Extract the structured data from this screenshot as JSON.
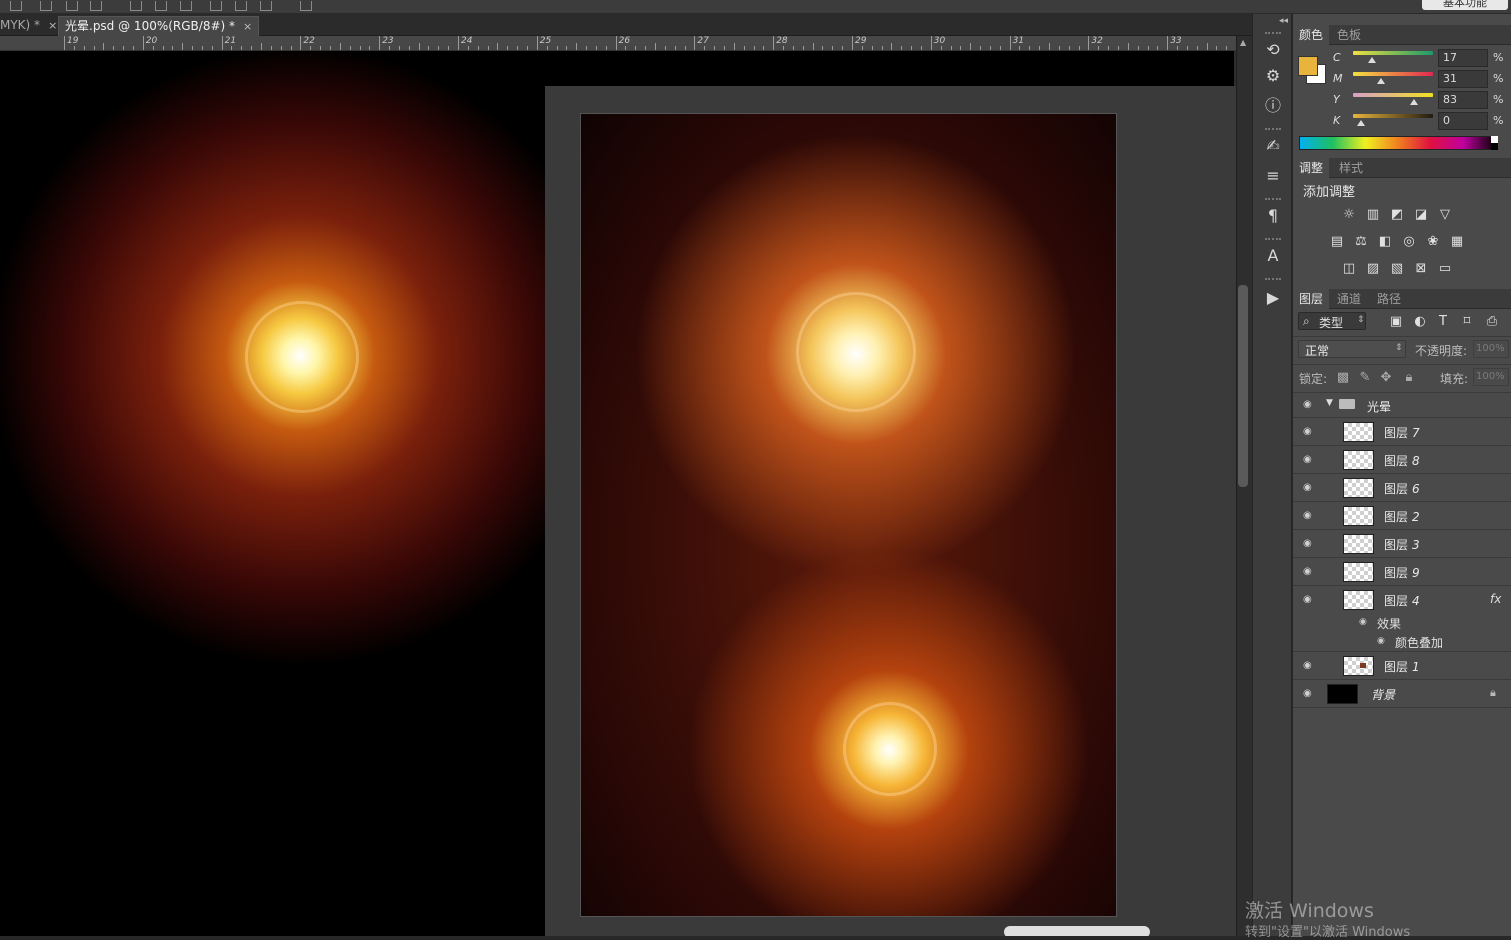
{
  "header": {
    "workspace_label": "基本功能"
  },
  "tabs": [
    {
      "label": "MYK) *",
      "close": "×"
    },
    {
      "label": "光晕.psd @ 100%(RGB/8#) *",
      "close": "×"
    }
  ],
  "ruler": {
    "numbers": [
      "19",
      "20",
      "21",
      "22",
      "23",
      "24",
      "25",
      "26",
      "27",
      "28",
      "29",
      "30",
      "31",
      "32",
      "33"
    ]
  },
  "color_panel": {
    "tabs": [
      "颜色",
      "色板"
    ],
    "foreground_color": "#e8b43c",
    "channels": [
      {
        "label": "C",
        "value": "17",
        "unit": "%",
        "level": 0.17
      },
      {
        "label": "M",
        "value": "31",
        "unit": "%",
        "level": 0.31
      },
      {
        "label": "Y",
        "value": "83",
        "unit": "%",
        "level": 0.83
      },
      {
        "label": "K",
        "value": "0",
        "unit": "%",
        "level": 0.0
      }
    ]
  },
  "adjust_panel": {
    "tabs": [
      "调整",
      "样式"
    ],
    "title": "添加调整"
  },
  "layers_panel": {
    "tabs": [
      "图层",
      "通道",
      "路径"
    ],
    "filter_label": "类型",
    "blend_mode": "正常",
    "opacity_label": "不透明度:",
    "opacity_value": "100%",
    "lock_label": "锁定:",
    "fill_label": "填充:",
    "fill_value": "100%",
    "group_name": "光晕",
    "layers": [
      {
        "name": "图层",
        "num": "7"
      },
      {
        "name": "图层",
        "num": "8"
      },
      {
        "name": "图层",
        "num": "6"
      },
      {
        "name": "图层",
        "num": "2"
      },
      {
        "name": "图层",
        "num": "3"
      },
      {
        "name": "图层",
        "num": "9"
      },
      {
        "name": "图层",
        "num": "4",
        "fx": "fx"
      }
    ],
    "effects_label": "效果",
    "effect_item": "颜色叠加",
    "layer1": {
      "name": "图层",
      "num": "1"
    },
    "background_name": "背景"
  },
  "watermark": {
    "line1": "激活 Windows",
    "line2": "转到\"设置\"以激活 Windows"
  }
}
